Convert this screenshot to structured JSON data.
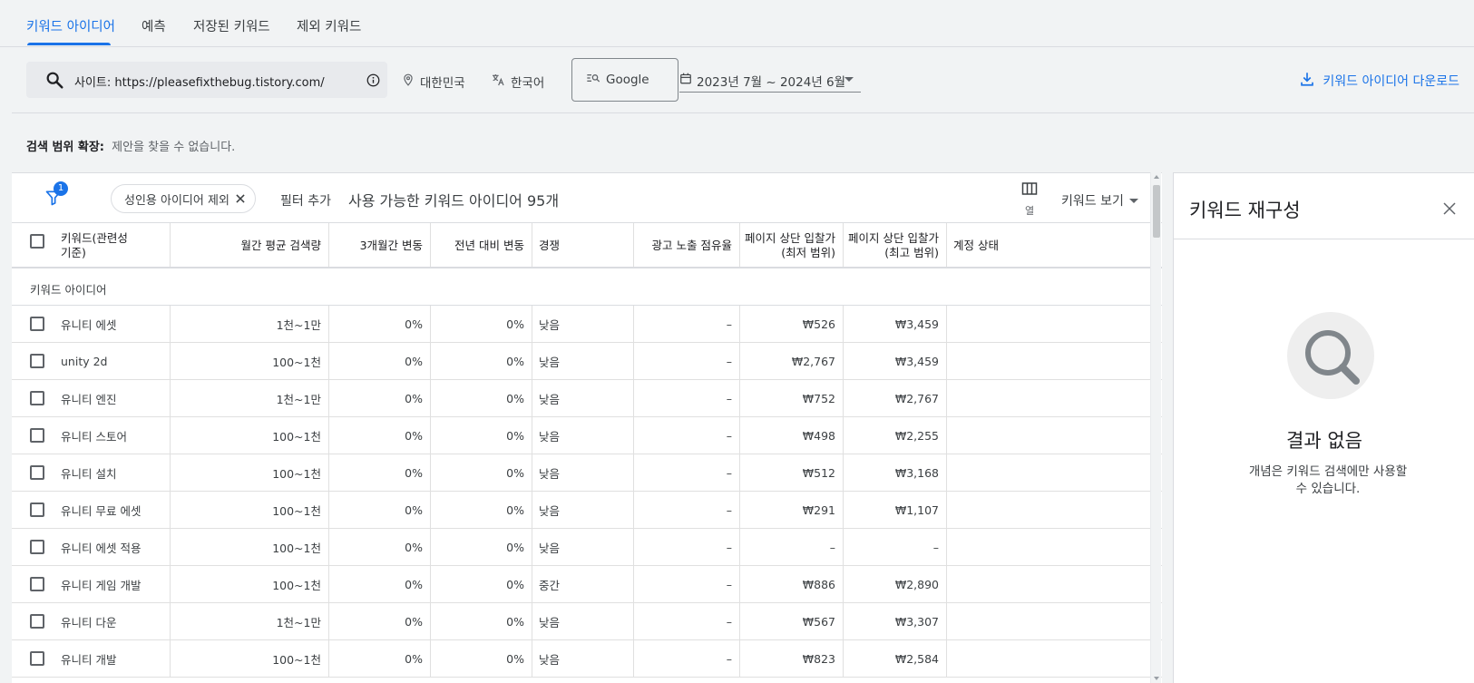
{
  "tabs": [
    {
      "label": "키워드 아이디어",
      "active": true
    },
    {
      "label": "예측"
    },
    {
      "label": "저장된 키워드"
    },
    {
      "label": "제외 키워드"
    }
  ],
  "toolbar": {
    "search_text": "사이트: https://pleasefixthebug.tistory.com/",
    "location": "대한민국",
    "language": "한국어",
    "network": "Google",
    "date_range": "2023년 7월 ~ 2024년 6월",
    "download_label": "키워드 아이디어 다운로드"
  },
  "expand": {
    "label": "검색 범위 확장:",
    "value": "제안을 찾을 수 없습니다."
  },
  "filter_bar": {
    "badge_count": "1",
    "chip_label": "성인용 아이디어 제외",
    "add_filter": "필터 추가",
    "available": "사용 가능한 키워드 아이디어 95개",
    "columns_label": "열",
    "view_label": "키워드 보기"
  },
  "table": {
    "headers": {
      "keyword_line1": "키워드(관련성",
      "keyword_line2": "기준)",
      "volume": "월간 평균 검색량",
      "change_3m": "3개월간 변동",
      "change_yoy": "전년 대비 변동",
      "competition": "경쟁",
      "impression_share": "광고 노출 점유율",
      "bid_low_line1": "페이지 상단 입찰가",
      "bid_low_line2": "(최저 범위)",
      "bid_high_line1": "페이지 상단 입찰가",
      "bid_high_line2": "(최고 범위)",
      "account_status": "계정 상태"
    },
    "group_label": "키워드 아이디어",
    "rows": [
      {
        "keyword": "유니티 에셋",
        "volume": "1천~1만",
        "change_3m": "0%",
        "change_yoy": "0%",
        "competition": "낮음",
        "impression_share": "–",
        "bid_low": "₩526",
        "bid_high": "₩3,459"
      },
      {
        "keyword": "unity 2d",
        "volume": "100~1천",
        "change_3m": "0%",
        "change_yoy": "0%",
        "competition": "낮음",
        "impression_share": "–",
        "bid_low": "₩2,767",
        "bid_high": "₩3,459"
      },
      {
        "keyword": "유니티 엔진",
        "volume": "1천~1만",
        "change_3m": "0%",
        "change_yoy": "0%",
        "competition": "낮음",
        "impression_share": "–",
        "bid_low": "₩752",
        "bid_high": "₩2,767"
      },
      {
        "keyword": "유니티 스토어",
        "volume": "100~1천",
        "change_3m": "0%",
        "change_yoy": "0%",
        "competition": "낮음",
        "impression_share": "–",
        "bid_low": "₩498",
        "bid_high": "₩2,255"
      },
      {
        "keyword": "유니티 설치",
        "volume": "100~1천",
        "change_3m": "0%",
        "change_yoy": "0%",
        "competition": "낮음",
        "impression_share": "–",
        "bid_low": "₩512",
        "bid_high": "₩3,168"
      },
      {
        "keyword": "유니티 무료 에셋",
        "volume": "100~1천",
        "change_3m": "0%",
        "change_yoy": "0%",
        "competition": "낮음",
        "impression_share": "–",
        "bid_low": "₩291",
        "bid_high": "₩1,107"
      },
      {
        "keyword": "유니티 에셋 적용",
        "volume": "100~1천",
        "change_3m": "0%",
        "change_yoy": "0%",
        "competition": "낮음",
        "impression_share": "–",
        "bid_low": "–",
        "bid_high": "–"
      },
      {
        "keyword": "유니티 게임 개발",
        "volume": "100~1천",
        "change_3m": "0%",
        "change_yoy": "0%",
        "competition": "중간",
        "impression_share": "–",
        "bid_low": "₩886",
        "bid_high": "₩2,890"
      },
      {
        "keyword": "유니티 다운",
        "volume": "1천~1만",
        "change_3m": "0%",
        "change_yoy": "0%",
        "competition": "낮음",
        "impression_share": "–",
        "bid_low": "₩567",
        "bid_high": "₩3,307"
      },
      {
        "keyword": "유니티 개발",
        "volume": "100~1천",
        "change_3m": "0%",
        "change_yoy": "0%",
        "competition": "낮음",
        "impression_share": "–",
        "bid_low": "₩823",
        "bid_high": "₩2,584"
      }
    ]
  },
  "panel": {
    "title": "키워드 재구성",
    "no_result_title": "결과 없음",
    "no_result_desc": "개념은 키워드 검색에만 사용할 수 있습니다."
  },
  "colors": {
    "accent": "#1a73e8",
    "background": "#f1f3f4",
    "text": "#3c4043",
    "border": "#dadce0"
  }
}
